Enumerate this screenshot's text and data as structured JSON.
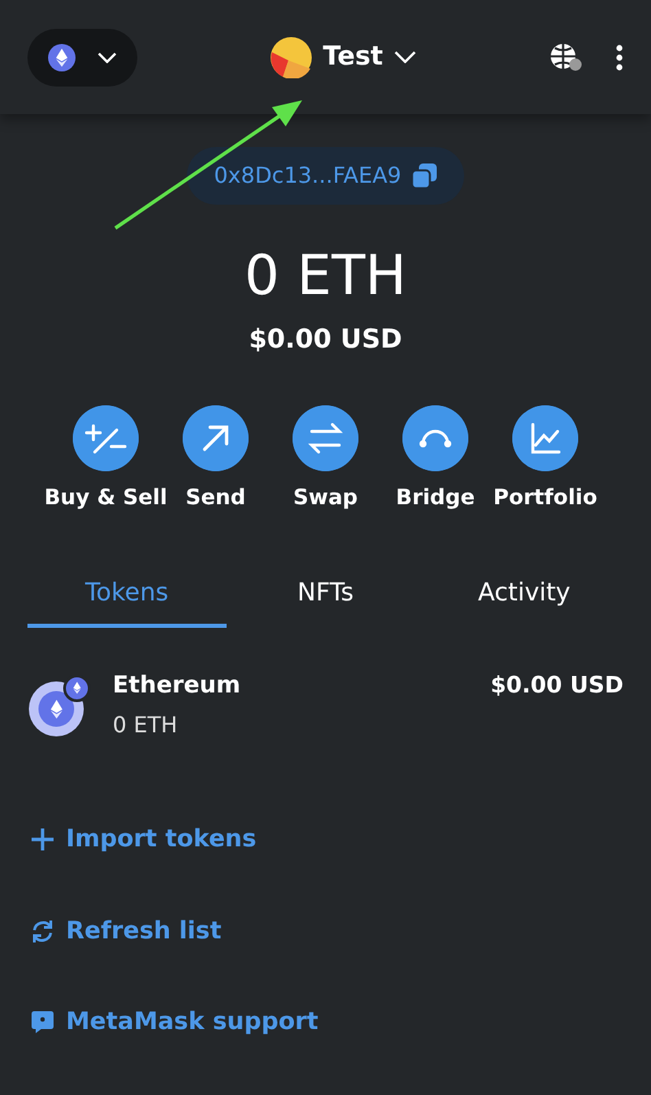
{
  "header": {
    "account_name": "Test"
  },
  "address": "0x8Dc13...FAEA9",
  "balance": {
    "primary": "0 ETH",
    "secondary": "$0.00 USD"
  },
  "actions": [
    {
      "kind": "buy-sell",
      "label": "Buy & Sell"
    },
    {
      "kind": "send",
      "label": "Send"
    },
    {
      "kind": "swap",
      "label": "Swap"
    },
    {
      "kind": "bridge",
      "label": "Bridge"
    },
    {
      "kind": "portfolio",
      "label": "Portfolio"
    }
  ],
  "tabs": [
    {
      "label": "Tokens",
      "selected": true
    },
    {
      "label": "NFTs",
      "selected": false
    },
    {
      "label": "Activity",
      "selected": false
    }
  ],
  "tokens": [
    {
      "name": "Ethereum",
      "amount": "0 ETH",
      "value": "$0.00 USD"
    }
  ],
  "links": [
    {
      "kind": "import",
      "label": "Import tokens"
    },
    {
      "kind": "refresh",
      "label": "Refresh list"
    },
    {
      "kind": "support",
      "label": "MetaMask support"
    }
  ]
}
